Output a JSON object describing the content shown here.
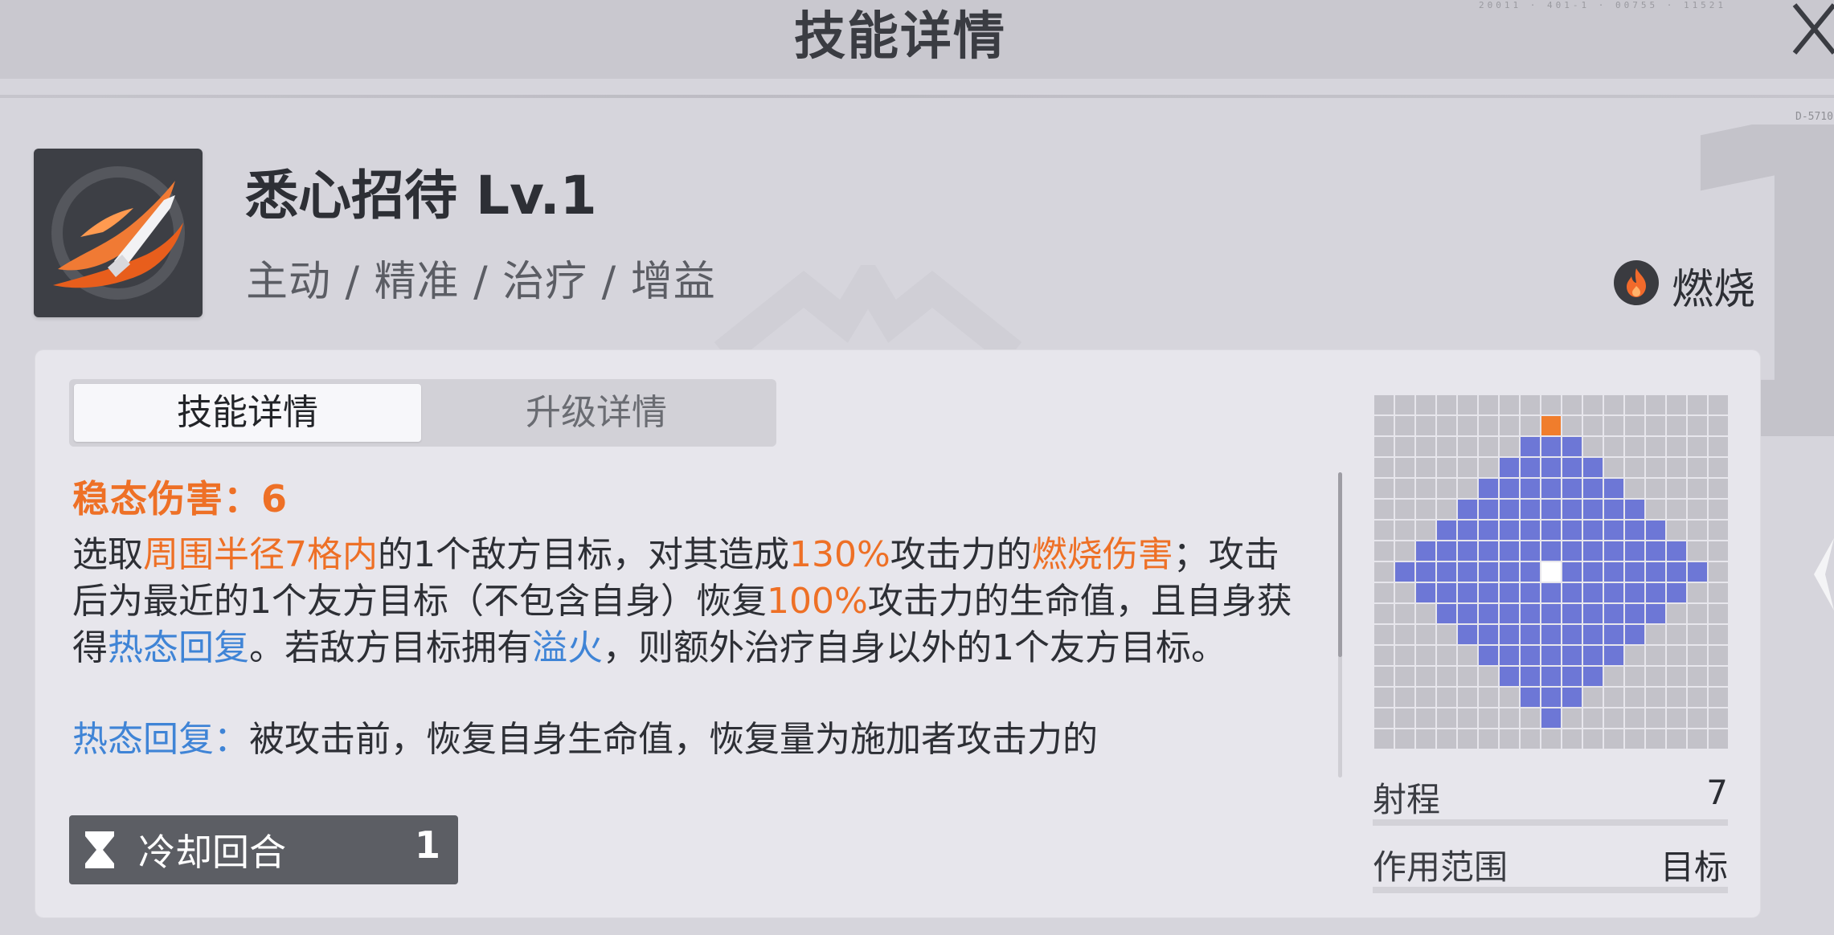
{
  "header": {
    "title": "技能详情",
    "deco": "20011 · 401-1 · 00755 · 11521",
    "corner_code": "D-5710"
  },
  "skill": {
    "name": "悉心招待 Lv.1",
    "tags": "主动 / 精准 / 治疗 / 增益",
    "element": "燃烧",
    "big_number": "1",
    "icon": "flame-blade-icon",
    "element_icon": "fire-icon"
  },
  "tabs": [
    {
      "label": "技能详情",
      "active": true
    },
    {
      "label": "升级详情",
      "active": false
    }
  ],
  "description": {
    "stability_label": "稳态伤害：",
    "stability_value": "6",
    "p1": [
      {
        "t": "选取",
        "c": ""
      },
      {
        "t": "周围半径7格内",
        "c": "o"
      },
      {
        "t": "的1个敌方目标，对其造成",
        "c": ""
      },
      {
        "t": "130%",
        "c": "o"
      },
      {
        "t": "攻击力的",
        "c": ""
      },
      {
        "t": "燃烧伤害",
        "c": "o"
      },
      {
        "t": "；攻击后为最近的1个友方目标（不包含自身）恢复",
        "c": ""
      },
      {
        "t": "100%",
        "c": "o"
      },
      {
        "t": "攻击力的生命值，且自身获得",
        "c": ""
      },
      {
        "t": "热态回复",
        "c": "b"
      },
      {
        "t": "。若敌方目标拥有",
        "c": ""
      },
      {
        "t": "溢火",
        "c": "b"
      },
      {
        "t": "，则额外治疗自身以外的1个友方目标。",
        "c": ""
      }
    ],
    "p2": [
      {
        "t": "热态回复：",
        "c": "b"
      },
      {
        "t": "被攻击前，恢复自身生命值，恢复量为施加者攻击力的",
        "c": ""
      }
    ]
  },
  "cooldown": {
    "icon": "hourglass-icon",
    "label": "冷却回合",
    "value": "1"
  },
  "range": {
    "grid_size": 17,
    "radius": 7,
    "top_marker_row": 1,
    "stats": [
      {
        "label": "射程",
        "value": "7"
      },
      {
        "label": "作用范围",
        "value": "目标"
      }
    ]
  },
  "colors": {
    "accent_orange": "#ee7026",
    "keyword_blue": "#3f84d6",
    "range_cell": "#6d77d6",
    "panel_bg": "#e7e6ec"
  }
}
